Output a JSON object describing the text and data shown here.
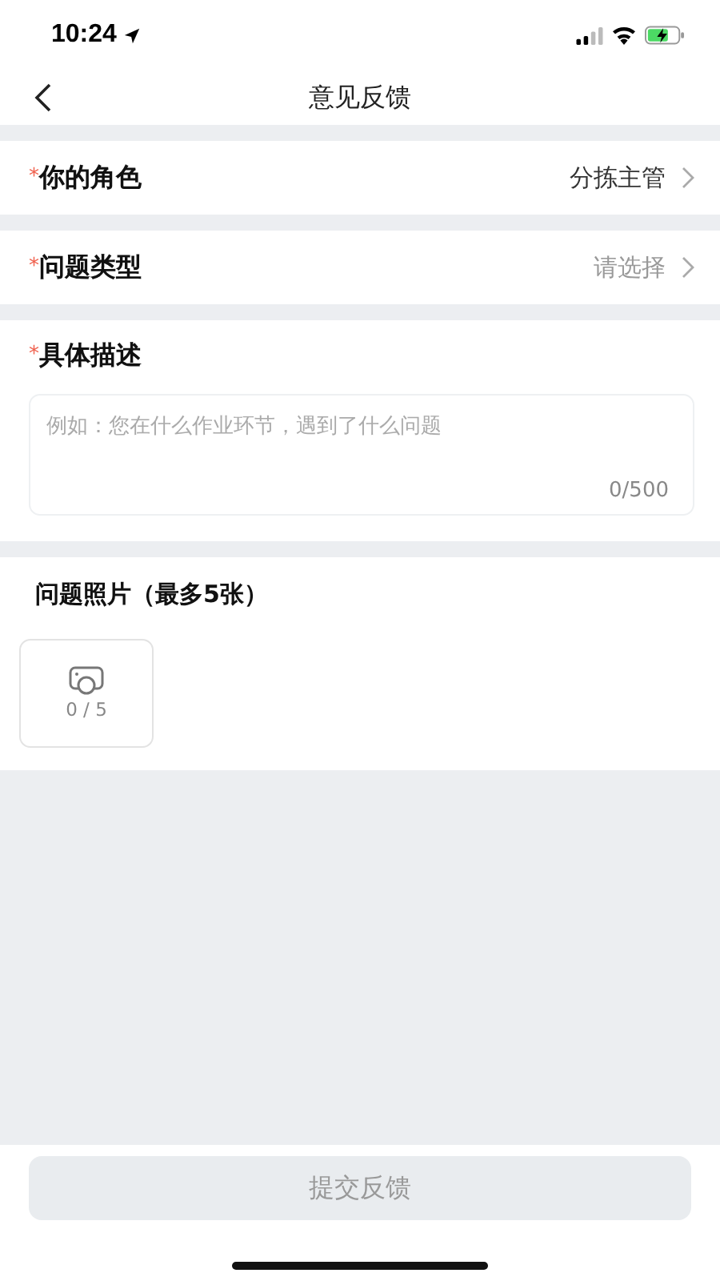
{
  "status_bar": {
    "time": "10:24"
  },
  "nav": {
    "title": "意见反馈"
  },
  "select_rows": [
    {
      "label": "你的角色",
      "required_mark": "*",
      "value": "分拣主管"
    },
    {
      "label": "问题类型",
      "required_mark": "*",
      "placeholder": "请选择"
    }
  ],
  "description": {
    "label": "具体描述",
    "required_mark": "*",
    "placeholder": "例如：您在什么作业环节，遇到了什么问题",
    "counter": "0/500"
  },
  "photos": {
    "title": "问题照片（最多5张）",
    "counter": "0 / 5"
  },
  "submit": {
    "label": "提交反馈",
    "disabled": true
  }
}
